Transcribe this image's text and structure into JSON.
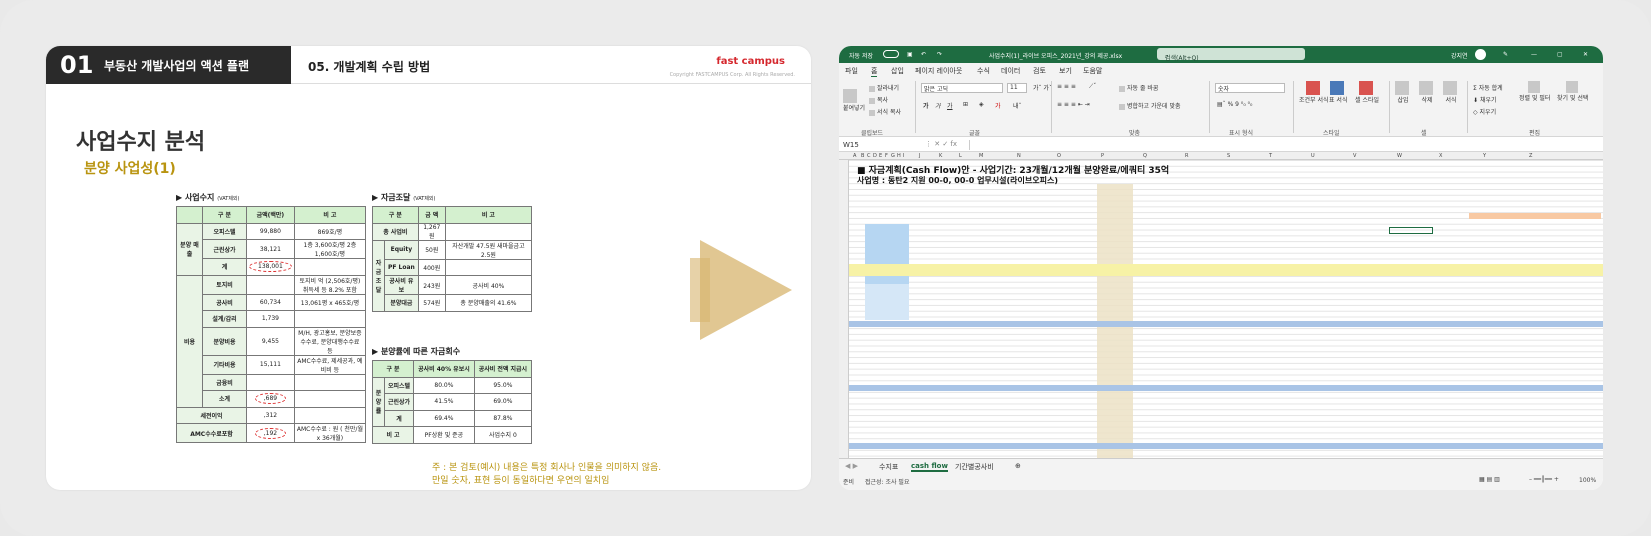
{
  "slide": {
    "header_num": "01",
    "header_title": "부동산 개발사업의 액션 플랜",
    "section": "05. 개발계획 수립 방법",
    "logo": "fast campus",
    "copyright": "Copyright FASTCAMPUS Corp. All Rights Reserved.",
    "title": "사업수지 분석",
    "subtitle": "분양 사업성(1)",
    "note_line1": "주 : 본 검토(예시) 내용은 특정 회사나 인물을 의미하지 않음.",
    "note_line2": "만일 숫자, 표현 등이 동일하다면 우연의 일치임",
    "t1": {
      "heading": "▶ 사업수지",
      "heading_small": "(VAT제외)",
      "headers": [
        "구 분",
        "금액(백만)",
        "비 고"
      ],
      "group_sales": "분양 매출",
      "group_cost": "비용",
      "rows": [
        [
          "오피스텔",
          "99,880",
          "869호/평"
        ],
        [
          "근린상가",
          "38,121",
          "1층 3,600호/평 2층 1,600호/평"
        ],
        [
          "계",
          "138,001",
          ""
        ],
        [
          "토지비",
          "",
          "토지비 억 (2,506호/평) 취득세 등 8.2% 포함"
        ],
        [
          "공사비",
          "60,734",
          "13,061평 x 465호/평"
        ],
        [
          "설계/감리",
          "1,739",
          ""
        ],
        [
          "분양비용",
          "9,455",
          "M/H, 광고홍보, 분양보증수수료, 분양대행수수료 등"
        ],
        [
          "기타비용",
          "15,111",
          "AMC수수료, 제세공과, 예비비 등"
        ],
        [
          "금융비",
          "",
          ""
        ],
        [
          "소계",
          ",689",
          ""
        ]
      ],
      "row_profit": [
        "세전이익",
        ",312",
        ""
      ],
      "row_amc": [
        "AMC수수료포함",
        ",192",
        "AMC수수료 : 원 ( 천만/월 x 36개월)"
      ]
    },
    "t2": {
      "heading": "▶ 자금조달",
      "heading_small": "(VAT제외)",
      "headers": [
        "구 분",
        "금 액",
        "비 고"
      ],
      "group": "자금 조달",
      "rows": [
        [
          "총 사업비",
          "1,267원",
          ""
        ],
        [
          "Equity",
          "50원",
          "자산개발 47.5원 새마을금고 2.5원"
        ],
        [
          "PF Loan",
          "400원",
          ""
        ],
        [
          "공사비 유보",
          "243원",
          "공사비 40%"
        ],
        [
          "분양대금",
          "574원",
          "총 분양매출의 41.6%"
        ]
      ]
    },
    "t3": {
      "heading": "▶ 분양률에 따른 자금회수",
      "headers": [
        "구 분",
        "공사비 40% 유보시",
        "공사비 전액 지급시"
      ],
      "group": "분양률",
      "rows": [
        [
          "오피스텔",
          "80.0%",
          "95.0%"
        ],
        [
          "근린상가",
          "41.5%",
          "69.0%"
        ],
        [
          "계",
          "69.4%",
          "87.8%"
        ],
        [
          "비 고",
          "PF상환 및 준공",
          "사업수지 0"
        ]
      ]
    }
  },
  "excel": {
    "autosave": "자동 저장",
    "filename": "사업수지(1)_라이브 오피스_2021년_강의 제공.xlsx",
    "search_placeholder": "검색(Alt+Q)",
    "user": "강지연",
    "menu": [
      "파일",
      "홈",
      "삽입",
      "페이지 레이아웃",
      "수식",
      "데이터",
      "검토",
      "보기",
      "도움말"
    ],
    "ribbon": {
      "paste": "붙여넣기",
      "cut": "잘라내기",
      "copy": "복사",
      "format_painter": "서식 복사",
      "clipboard": "클립보드",
      "font_name": "맑은 고딕",
      "font_size": "11",
      "font_group": "글꼴",
      "wrap": "자동 줄 바꿈",
      "merge": "병합하고 가운데 맞춤",
      "align_group": "맞춤",
      "number_format": "숫자",
      "number_group": "표시 형식",
      "cond_format": "조건부 서식",
      "table_format": "표 서식",
      "cell_style": "셀 스타일",
      "style_group": "스타일",
      "insert": "삽입",
      "delete": "삭제",
      "format": "서식",
      "cell_group": "셀",
      "autosum": "자동 합계",
      "fill": "채우기",
      "clear": "지우기",
      "sort": "정렬 및 필터",
      "find": "찾기 및 선택",
      "edit_group": "편집"
    },
    "name_box": "W15",
    "columns": [
      "A",
      "B",
      "C",
      "D",
      "E",
      "F",
      "G",
      "H",
      "I",
      "J",
      "K",
      "L",
      "M",
      "N",
      "O",
      "P",
      "Q",
      "R",
      "S",
      "T",
      "U",
      "V",
      "W",
      "X",
      "Y",
      "Z"
    ],
    "sheet_title": "■ 자금계획(Cash Flow)안 - 사업기간: 23개월/12개월 분양완료/에쿼티 35억",
    "sheet_sub": "사업명 :   동탄2 지원 00-0, 00-0 업무시설(라이브오피스)",
    "tabs": [
      "수지표",
      "cash flow",
      "기간별공사비"
    ],
    "status_left": "준비",
    "status_acc": "접근성: 조사 필요",
    "zoom": "100%"
  }
}
